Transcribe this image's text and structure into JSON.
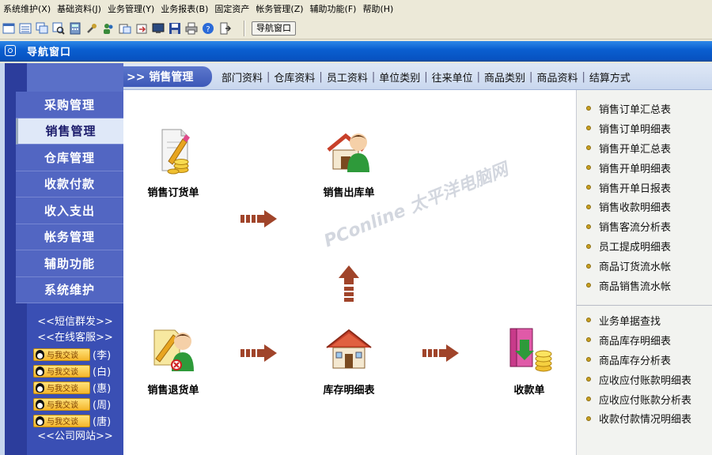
{
  "menubar": [
    "系统维护(X)",
    "基础资料(J)",
    "业务管理(Y)",
    "业务报表(B)",
    "固定资产",
    "帐务管理(Z)",
    "辅助功能(F)",
    "帮助(H)"
  ],
  "toolbar": {
    "nav_button": "导航窗口"
  },
  "window": {
    "title": "导航窗口"
  },
  "sidebar": {
    "items": [
      {
        "label": "采购管理"
      },
      {
        "label": "销售管理"
      },
      {
        "label": "仓库管理"
      },
      {
        "label": "收款付款"
      },
      {
        "label": "收入支出"
      },
      {
        "label": "帐务管理"
      },
      {
        "label": "辅助功能"
      },
      {
        "label": "系统维护"
      }
    ],
    "active_index": 1,
    "sms": "<<短信群发>>",
    "online": "<<在线客服>>",
    "qq_button": "与我交谈",
    "qq_contacts": [
      "(李)",
      "(白)",
      "(惠)",
      "(周)",
      "(唐)"
    ],
    "website": "<<公司网站>>"
  },
  "category": {
    "current": ">> 销售管理",
    "tabs": [
      "部门资料",
      "仓库资料",
      "员工资料",
      "单位类别",
      "往来单位",
      "商品类别",
      "商品资料",
      "结算方式"
    ],
    "separator": "|"
  },
  "flow": {
    "sales_order": "销售订货单",
    "sales_outbound": "销售出库单",
    "sales_return": "销售退货单",
    "inventory_detail": "库存明细表",
    "receipt": "收款单",
    "watermark": "PConline 太平洋电脑网"
  },
  "right_panel": {
    "group1": [
      "销售订单汇总表",
      "销售订单明细表",
      "销售开单汇总表",
      "销售开单明细表",
      "销售开单日报表",
      "销售收款明细表",
      "销售客流分析表",
      "员工提成明细表",
      "商品订货流水帐",
      "商品销售流水帐"
    ],
    "group2": [
      "业务单据查找",
      "商品库存明细表",
      "商品库存分析表",
      "应收应付账款明细表",
      "应收应付账款分析表",
      "收款付款情况明细表"
    ]
  },
  "colors": {
    "title_bar": "#0a5fd0",
    "sidebar": "#3a4fb4",
    "arrow": "#a0442a",
    "bullet": "#c9a020"
  }
}
